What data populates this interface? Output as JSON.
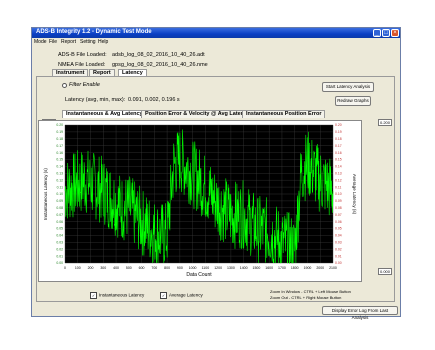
{
  "window": {
    "title": "ADS-B Integrity 1.2 - Dynamic Test Mode"
  },
  "menu": [
    "Mode",
    "File",
    "Report",
    "Setting",
    "Help"
  ],
  "files": {
    "adsb_label": "ADS-B File Loaded:",
    "adsb_value": "adsb_log_08_02_2016_10_40_26.adt",
    "nmea_label": "NMEA File Loaded:",
    "nmea_value": "gpsg_log_08_02_2016_10_40_26.nme"
  },
  "main_tabs": [
    "Instrument",
    "Report",
    "Latency"
  ],
  "filter_label": "Filter Enable",
  "latency": {
    "label": "Latency (avg, min, max):",
    "value": "0.091, 0.002, 0.196 s"
  },
  "buttons": {
    "start": "Start Latency Analysis",
    "redraw": "Redraw Graphs",
    "display_log": "Display Error Log From Last Analysis"
  },
  "chart_tabs": [
    "Instantaneous & Avg Latency",
    "Position Error & Velocity @ Avg Latency",
    "Instantaneous Position Error"
  ],
  "side_boxes": {
    "left_top": "0.200",
    "right_top": "0.200",
    "left_bottom": "0.000",
    "right_bottom": "0.000"
  },
  "checkboxes": {
    "instantaneous": "Instantaneous Latency",
    "average": "Average Latency"
  },
  "zoom_help": {
    "zoom_in": "Zoom In Window - CTRL + Left Mouse Button",
    "zoom_out": "Zoom Out - CTRL + Right Mouse Button"
  },
  "chart_data": {
    "type": "line",
    "xlabel": "Data Count",
    "ylabel": "Instantaneous Latency (s)",
    "y2label": "Average Latency (s)",
    "xlim": [
      0,
      2100
    ],
    "ylim": [
      0,
      0.2
    ],
    "xticks": [
      0,
      100,
      200,
      300,
      400,
      500,
      600,
      700,
      800,
      900,
      1000,
      1100,
      1200,
      1300,
      1400,
      1500,
      1600,
      1700,
      1800,
      1900,
      2000,
      2100
    ],
    "yticks": [
      0.2,
      0.19,
      0.18,
      0.17,
      0.16,
      0.15,
      0.14,
      0.13,
      0.12,
      0.11,
      0.1,
      0.09,
      0.08,
      0.07,
      0.06,
      0.05,
      0.04,
      0.03,
      0.02,
      0.01,
      0.0
    ],
    "grid": true,
    "series": [
      {
        "name": "Instantaneous Latency",
        "color": "#00ff00",
        "x": [
          0,
          150,
          300,
          450,
          500,
          600,
          700,
          750,
          800,
          850,
          900,
          1000,
          1100,
          1200,
          1300,
          1400,
          1500,
          1600,
          1700,
          1800,
          1850,
          1900,
          2000,
          2100
        ],
        "y": [
          0.105,
          0.12,
          0.105,
          0.08,
          0.08,
          0.06,
          0.045,
          0.04,
          0.04,
          0.14,
          0.15,
          0.13,
          0.11,
          0.085,
          0.07,
          0.07,
          0.05,
          0.045,
          0.03,
          0.02,
          0.13,
          0.145,
          0.12,
          0.105
        ],
        "spread": 0.05
      }
    ]
  }
}
